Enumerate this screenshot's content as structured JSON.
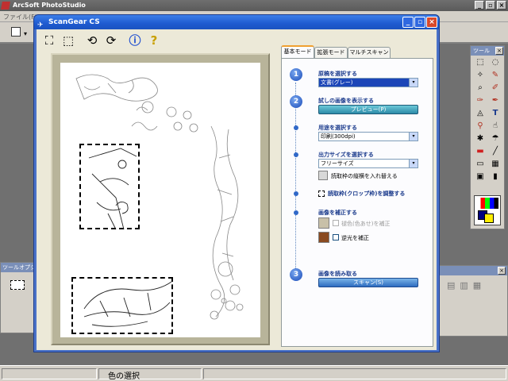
{
  "app": {
    "title": "ArcSoft PhotoStudio",
    "menu_file": "ファイル(F)",
    "status_text": "色の選択",
    "tool_options_title": "ツールオプション",
    "tools_title": "ツール",
    "close_glyph": "×",
    "minimize_glyph": "_",
    "restore_glyph": "▫",
    "dropdown_glyph": "▾"
  },
  "dialog": {
    "title": "ScanGear CS",
    "tabs": [
      "基本モード",
      "拡張モード",
      "マルチスキャン"
    ],
    "steps": {
      "step1_num": "1",
      "step1_label": "原稿を選択する",
      "source_value": "文書(グレー)",
      "step2_num": "2",
      "step2_label": "試しの画像を表示する",
      "preview_button": "プレビュー(P)",
      "purpose_label": "用途を選択する",
      "purpose_value": "印刷(300dpi)",
      "output_label": "出力サイズを選択する",
      "output_value": "フリーサイズ",
      "swap_crop_label": "読取枠の縦横を入れ替える",
      "crop_adjust_label": "読取枠(クロップ枠)を調整する",
      "correct_label": "画像を補正する",
      "fade_label": "褪色(色あせ)を補正",
      "backlight_label": "逆光を補正",
      "step3_num": "3",
      "step3_label": "画像を読み取る",
      "scan_button": "スキャン(S)"
    }
  },
  "colors": {
    "dialog_title": "#1e5ad0",
    "panel_label": "#1a3a8c",
    "accent_teal": "#2c8aa8",
    "selection": "#1c46b8"
  }
}
